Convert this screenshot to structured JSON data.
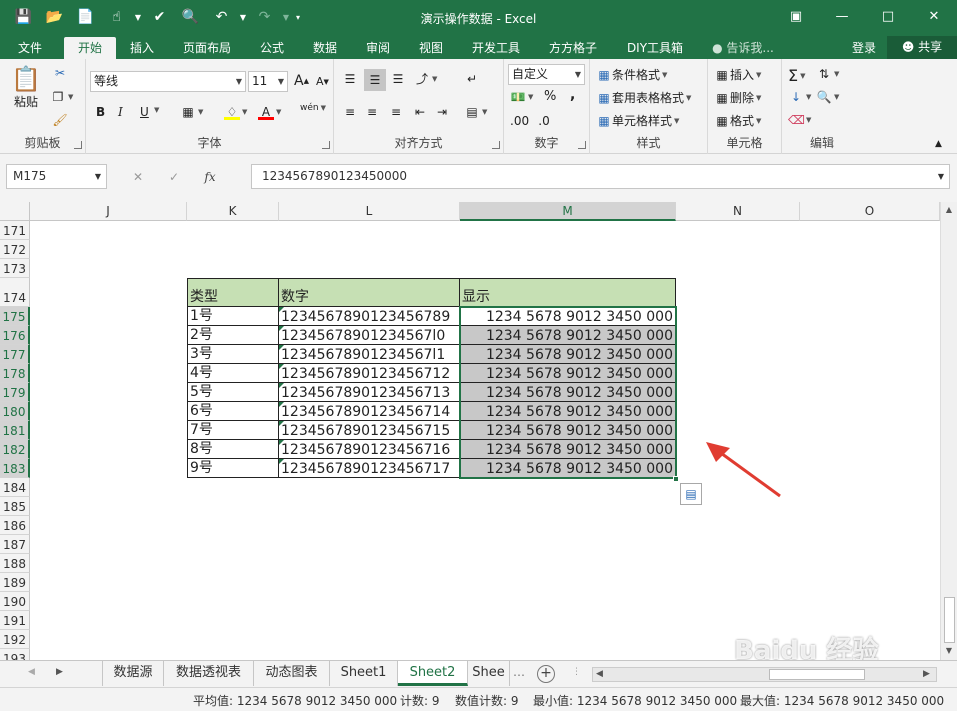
{
  "window": {
    "title": "演示操作数据 - Excel"
  },
  "ribbon_tabs": [
    "文件",
    "开始",
    "插入",
    "页面布局",
    "公式",
    "数据",
    "审阅",
    "视图",
    "开发工具",
    "方方格子",
    "DIY工具箱"
  ],
  "tell_me": "告诉我...",
  "login": "登录",
  "share": "共享",
  "clipboard": {
    "paste": "粘贴",
    "label": "剪贴板"
  },
  "font": {
    "name": "等线",
    "size": "11",
    "label": "字体",
    "bold": "B",
    "italic": "I",
    "underline": "U",
    "increase": "A",
    "decrease": "A",
    "wen": "wén"
  },
  "alignment": {
    "label": "对齐方式"
  },
  "number": {
    "format": "自定义",
    "label": "数字",
    "percent": "%",
    "comma": ","
  },
  "styles": {
    "conditional": "条件格式",
    "table": "套用表格格式",
    "cell_styles": "单元格样式",
    "label": "样式"
  },
  "cells": {
    "insert": "插入",
    "delete": "删除",
    "format": "格式",
    "label": "单元格"
  },
  "editing": {
    "label": "编辑"
  },
  "formula_bar": {
    "name_box": "M175",
    "formula": "1234567890123450000"
  },
  "columns": [
    "J",
    "K",
    "L",
    "M",
    "N",
    "O"
  ],
  "rows": [
    "171",
    "172",
    "173",
    "174",
    "175",
    "176",
    "177",
    "178",
    "179",
    "180",
    "181",
    "182",
    "183",
    "184",
    "185",
    "186",
    "187",
    "188",
    "189",
    "190",
    "191",
    "192",
    "193"
  ],
  "table": {
    "headers": [
      "类型",
      "数字",
      "显示"
    ],
    "rows": [
      [
        "1号",
        "1234567890123456789",
        "1234 5678 9012 3450 000"
      ],
      [
        "2号",
        "12345678901234567l0",
        "1234 5678 9012 3450 000"
      ],
      [
        "3号",
        "12345678901234567l1",
        "1234 5678 9012 3450 000"
      ],
      [
        "4号",
        "1234567890123456712",
        "1234 5678 9012 3450 000"
      ],
      [
        "5号",
        "1234567890123456713",
        "1234 5678 9012 3450 000"
      ],
      [
        "6号",
        "1234567890123456714",
        "1234 5678 9012 3450 000"
      ],
      [
        "7号",
        "1234567890123456715",
        "1234 5678 9012 3450 000"
      ],
      [
        "8号",
        "1234567890123456716",
        "1234 5678 9012 3450 000"
      ],
      [
        "9号",
        "1234567890123456717",
        "1234 5678 9012 3450 000"
      ]
    ]
  },
  "sheet_tabs": [
    "数据源",
    "数据透视表",
    "动态图表",
    "Sheet1",
    "Sheet2",
    "Shee"
  ],
  "active_sheet": "Sheet2",
  "status": {
    "average": "平均值: 1234 5678 9012 3450 000",
    "count": "计数: 9",
    "numeric_count": "数值计数: 9",
    "min": "最小值: 1234 5678 9012 3450 000",
    "max": "最大值: 1234 5678 9012 3450 000"
  },
  "watermark": "Baidu 经验",
  "colors": {
    "excel_green": "#217346",
    "header_fill": "#c6e0b4",
    "selection_fill": "#c8c8c8",
    "arrow": "#e03c31"
  }
}
